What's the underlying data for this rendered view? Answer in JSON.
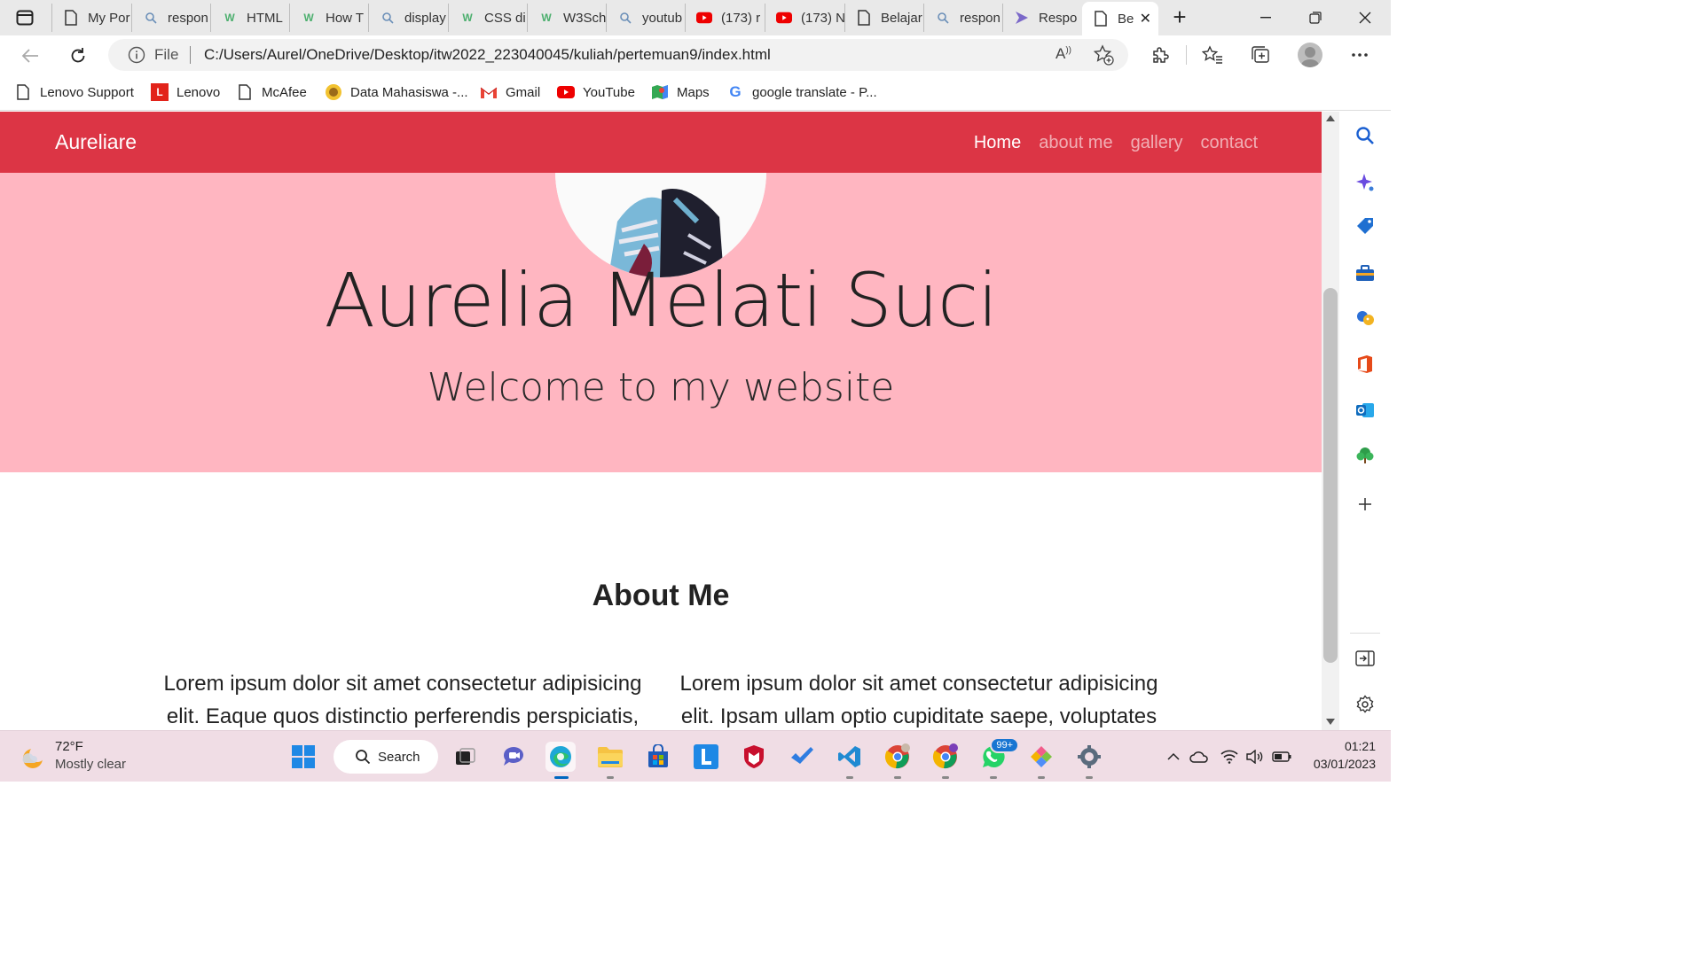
{
  "browser": {
    "tabs": [
      {
        "title": "My Por",
        "icon": "page-icon"
      },
      {
        "title": "respon",
        "icon": "search-icon"
      },
      {
        "title": "HTML",
        "icon": "w3schools-icon"
      },
      {
        "title": "How T",
        "icon": "w3schools-icon"
      },
      {
        "title": "display",
        "icon": "search-icon"
      },
      {
        "title": "CSS di",
        "icon": "w3schools-icon"
      },
      {
        "title": "W3Sch",
        "icon": "w3schools-icon"
      },
      {
        "title": "youtub",
        "icon": "search-icon"
      },
      {
        "title": "(173) r",
        "icon": "youtube-icon"
      },
      {
        "title": "(173) N",
        "icon": "youtube-icon"
      },
      {
        "title": "Belajar",
        "icon": "page-icon"
      },
      {
        "title": "respon",
        "icon": "search-icon"
      },
      {
        "title": "Respo",
        "icon": "copilot-icon"
      },
      {
        "title": "Be",
        "icon": "page-icon",
        "active": true
      }
    ],
    "address": {
      "scheme_label": "File",
      "url": "C:/Users/Aurel/OneDrive/Desktop/itw2022_223040045/kuliah/pertemuan9/index.html",
      "read_aloud_label": "A))"
    },
    "favorites": [
      {
        "label": "Lenovo Support",
        "icon": "page-icon"
      },
      {
        "label": "Lenovo",
        "icon": "lenovo-icon"
      },
      {
        "label": "McAfee",
        "icon": "page-icon"
      },
      {
        "label": "Data Mahasiswa -...",
        "icon": "university-seal-icon"
      },
      {
        "label": "Gmail",
        "icon": "gmail-icon"
      },
      {
        "label": "YouTube",
        "icon": "youtube-icon"
      },
      {
        "label": "Maps",
        "icon": "maps-icon"
      },
      {
        "label": "google translate - P...",
        "icon": "google-icon"
      }
    ]
  },
  "site": {
    "brand": "Aureliare",
    "nav": [
      {
        "label": "Home",
        "current": true
      },
      {
        "label": "about me"
      },
      {
        "label": "gallery"
      },
      {
        "label": "contact"
      }
    ],
    "hero": {
      "name": "Aurelia Melati Suci",
      "tagline": "Welcome to my website"
    },
    "about": {
      "title": "About Me",
      "col1_line1": "Lorem ipsum dolor sit amet consectetur adipisicing",
      "col1_line2": "elit. Eaque quos distinctio perferendis perspiciatis,",
      "col2_line1": "Lorem ipsum dolor sit amet consectetur adipisicing",
      "col2_line2": "elit. Ipsam ullam optio cupiditate saepe, voluptates"
    }
  },
  "colors": {
    "navbar": "#dc3545",
    "hero_bg": "#ffb6c1"
  },
  "taskbar": {
    "weather_temp": "72°F",
    "weather_condition": "Mostly clear",
    "search_label": "Search",
    "whatsapp_badge": "99+",
    "time": "01:21",
    "date": "03/01/2023"
  }
}
